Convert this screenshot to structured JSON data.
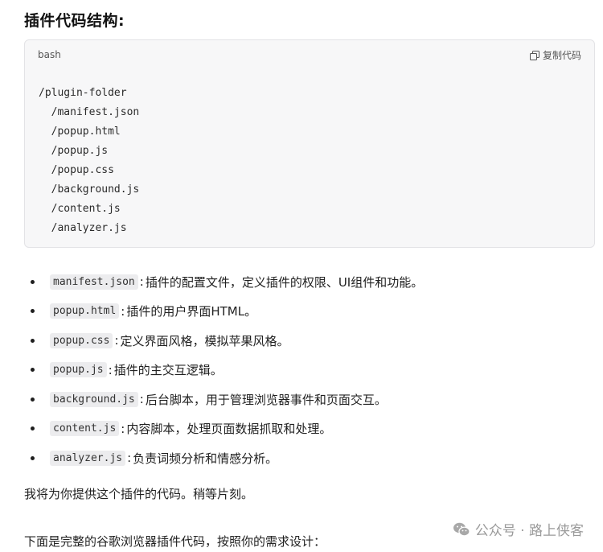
{
  "heading": "插件代码结构:",
  "code_block": {
    "language": "bash",
    "copy_label": "复制代码",
    "lines": [
      "/plugin-folder",
      "  /manifest.json",
      "  /popup.html",
      "  /popup.js",
      "  /popup.css",
      "  /background.js",
      "  /content.js",
      "  /analyzer.js"
    ]
  },
  "bullets": [
    {
      "code": "manifest.json",
      "text": "插件的配置文件，定义插件的权限、UI组件和功能。"
    },
    {
      "code": "popup.html",
      "text": "插件的用户界面HTML。"
    },
    {
      "code": "popup.css",
      "text": "定义界面风格，模拟苹果风格。"
    },
    {
      "code": "popup.js",
      "text": "插件的主交互逻辑。"
    },
    {
      "code": "background.js",
      "text": "后台脚本，用于管理浏览器事件和页面交互。"
    },
    {
      "code": "content.js",
      "text": "内容脚本，处理页面数据抓取和处理。"
    },
    {
      "code": "analyzer.js",
      "text": "负责词频分析和情感分析。"
    }
  ],
  "paragraph1": "我将为你提供这个插件的代码。稍等片刻。",
  "paragraph2": "下面是完整的谷歌浏览器插件代码，按照你的需求设计：",
  "watermark": "公众号 · 路上侠客",
  "icons": {
    "copy": "copy-icon",
    "watermark": "wechat-icon"
  }
}
